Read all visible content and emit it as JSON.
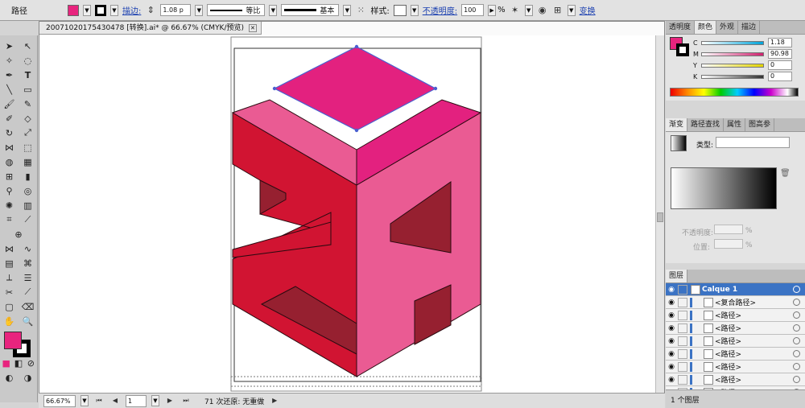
{
  "control_bar": {
    "object_type": "路径",
    "fill_color": "#e8247e",
    "stroke_label": "描边:",
    "stroke_weight": "1.08 p",
    "profile_uniform": "等比",
    "brush_basic": "基本",
    "style_label": "样式:",
    "opacity_label": "不透明度:",
    "opacity_value": "100",
    "opacity_unit": "%",
    "transform_label": "变换"
  },
  "document_tab": {
    "title": "20071020175430478 [转换].ai* @ 66.67% (CMYK/预览)",
    "close_icon": "close-icon"
  },
  "tools": {
    "fill_color": "#e8247e",
    "stroke_color": "#000000"
  },
  "artwork": {
    "top_face_color": "#e3217f",
    "left_face_color": "#d11432",
    "right_face_color": "#ea5b93",
    "shadow_color": "#962030",
    "selection_color": "#4a5fd0"
  },
  "status_bar": {
    "zoom": "66.67%",
    "page": "1",
    "undo_text": "71 次还原: 无重做"
  },
  "color_panel": {
    "tabs": [
      "透明度",
      "颜色",
      "外观",
      "描边"
    ],
    "active_tab": "颜色",
    "channels": [
      {
        "name": "C",
        "value": "1.18",
        "color": "#00a3d9"
      },
      {
        "name": "M",
        "value": "90.98",
        "color": "#d0206e"
      },
      {
        "name": "Y",
        "value": "0",
        "color": "#e3d400"
      },
      {
        "name": "K",
        "value": "0",
        "color": "#333333"
      }
    ],
    "fill_color": "#e8247e"
  },
  "gradient_panel": {
    "tabs": [
      "渐变",
      "路径查找",
      "属性",
      "图高参"
    ],
    "active_tab": "渐变",
    "type_label": "类型:",
    "opacity_label": "不透明度:",
    "opacity_unit": "%",
    "position_label": "位置:",
    "position_unit": "%"
  },
  "layers_panel": {
    "title": "图层",
    "layer_name": "Calque 1",
    "items": [
      "<复合路径>",
      "<路径>",
      "<路径>",
      "<路径>",
      "<路径>",
      "<路径>",
      "<路径>",
      "<路径>",
      "<路径>"
    ],
    "footer": "1 个图层"
  }
}
